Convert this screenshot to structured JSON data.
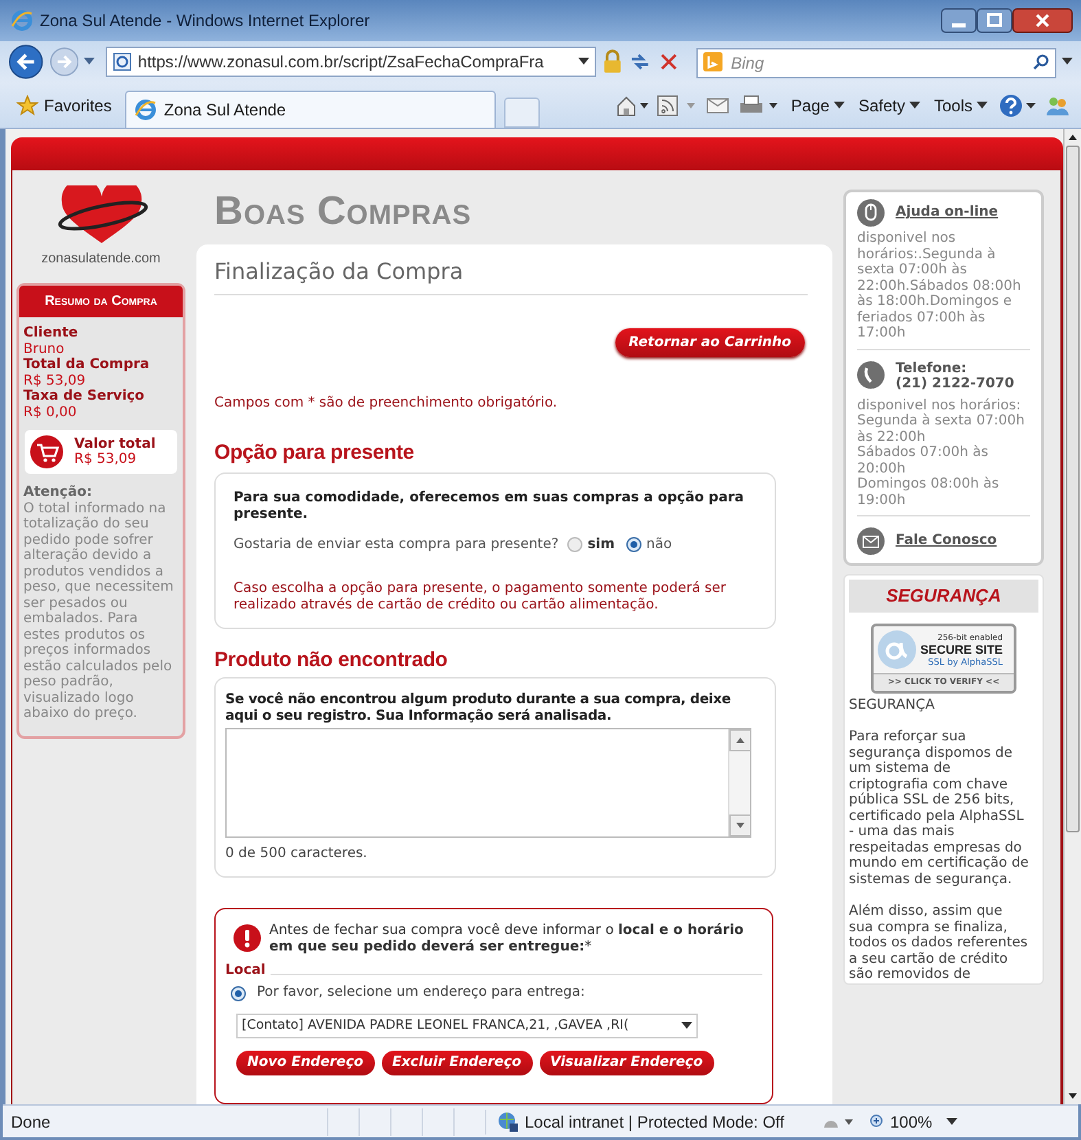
{
  "browser": {
    "title": "Zona Sul Atende - Windows Internet Explorer",
    "address": "https://www.zonasul.com.br/script/ZsaFechaCompraFra",
    "search_placeholder": "Bing",
    "favorites": "Favorites",
    "tab": "Zona Sul Atende",
    "menus": [
      "Page",
      "Safety",
      "Tools"
    ]
  },
  "logo_text": "zonasulatende.com",
  "banner": "Boas Compras",
  "summary": {
    "title": "Resumo da Compra",
    "fields": [
      {
        "label": "Cliente",
        "value": "Bruno"
      },
      {
        "label": "Total da Compra",
        "value": "R$ 53,09"
      },
      {
        "label": "Taxa de Serviço",
        "value": "R$ 0,00"
      }
    ],
    "total_label": "Valor total",
    "total_value": "R$ 53,09",
    "attention_title": "Atenção:",
    "attention_text": "O total informado na totalização do seu pedido pode sofrer alteração devido a produtos vendidos a peso, que necessitem ser pesados ou embalados. Para estes produtos os preços informados estão calculados pelo peso padrão, visualizado logo abaixo do preço."
  },
  "main": {
    "title": "Finalização da Compra",
    "return_button": "Retornar ao Carrinho",
    "required_note": "Campos com * são de preenchimento obrigatório.",
    "gift": {
      "heading": "Opção para presente",
      "intro": "Para sua comodidade, oferecemos em suas compras a opção para presente.",
      "question": "Gostaria de enviar esta compra para presente?",
      "options": [
        {
          "label": "sim",
          "selected": false
        },
        {
          "label": "não",
          "selected": true
        }
      ],
      "warning": "Caso escolha a opção para presente, o pagamento somente poderá ser realizado através de cartão de crédito ou cartão alimentação."
    },
    "product": {
      "heading": "Produto não encontrado",
      "intro": "Se você não encontrou algum produto durante a sua compra, deixe aqui o seu registro. Sua Informação será analisada.",
      "counter": "0 de 500 caracteres."
    },
    "delivery": {
      "notice": "Antes de fechar sua compra você deve informar o **local e o horário em que seu pedido deverá ser entregue:***",
      "local_label": "Local",
      "address_option": {
        "label": "Por favor, selecione um endereço para entrega:",
        "selected": true
      },
      "address_value": "[Contato] AVENIDA PADRE LEONEL FRANCA,21, ,GAVEA ,RI(",
      "buttons": [
        "Novo Endereço",
        "Excluir Endereço",
        "Visualizar Endereço"
      ]
    }
  },
  "help": {
    "chat_link": "Ajuda on-line",
    "chat_hours": "disponivel nos horários:.Segunda à sexta 07:00h às 22:00h.Sábados 08:00h às 18:00h.Domingos e feriados 07:00h às 17:00h",
    "phone_label": "Telefone:",
    "phone_number": "(21) 2122-7070",
    "phone_hours": [
      "disponivel nos horários:",
      "Segunda à sexta 07:00h às 22:00h",
      "Sábados 07:00h às 20:00h",
      "Domingos 08:00h às 19:00h"
    ],
    "contact_link": "Fale Conosco"
  },
  "security": {
    "heading": "SEGURANÇA",
    "badge": [
      "256-bit enabled",
      "SECURE SITE",
      "SSL by AlphaSSL",
      ">> CLICK TO VERIFY <<"
    ],
    "caption": "SEGURANÇA",
    "paragraphs": [
      "Para reforçar sua segurança dispomos de um sistema de criptografia com chave pública SSL de 256 bits, certificado pela AlphaSSL - uma das mais respeitadas empresas do mundo em certificação de sistemas de segurança.",
      "Além disso, assim que sua compra se finaliza, todos os dados referentes a seu cartão de crédito são removidos de"
    ]
  },
  "status_bar": {
    "text": "Done",
    "zone": "Local intranet | Protected Mode: Off",
    "zoom": "100%"
  }
}
